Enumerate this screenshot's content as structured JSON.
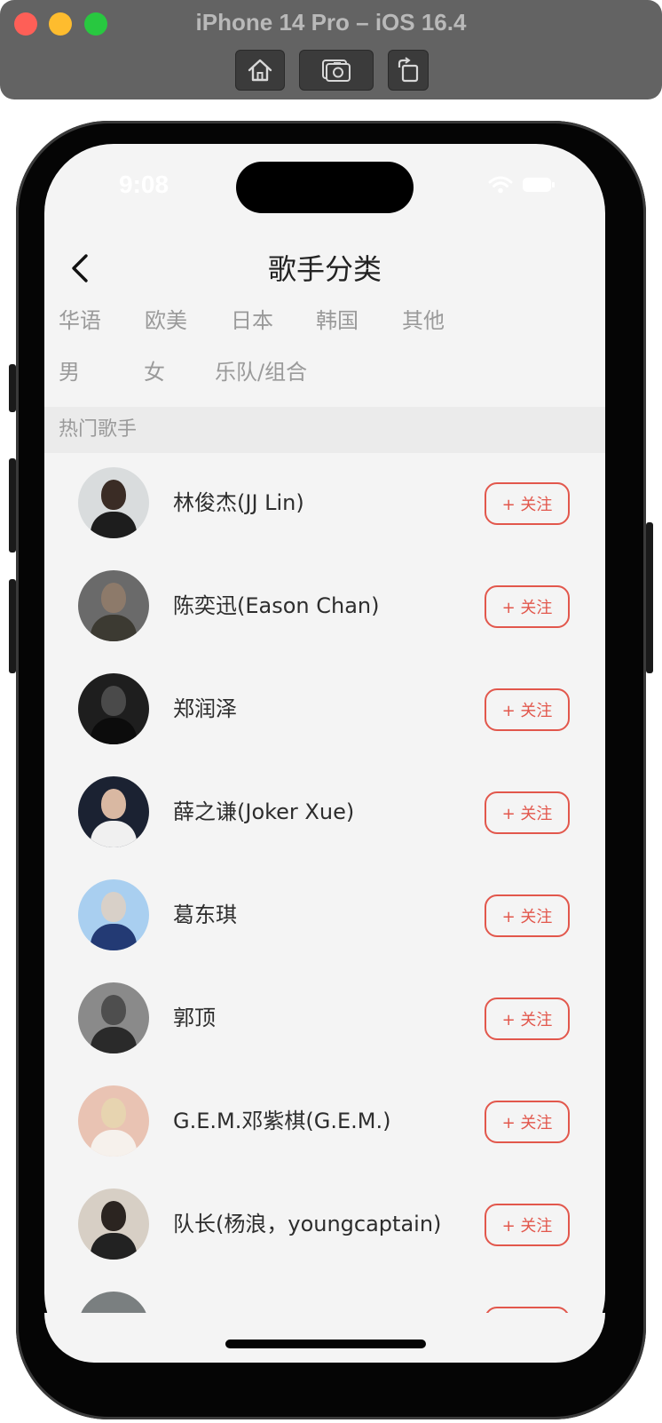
{
  "simulator": {
    "title": "iPhone 14 Pro – iOS 16.4",
    "buttons": [
      "home-icon",
      "screenshot-icon",
      "rotate-icon"
    ]
  },
  "status_bar": {
    "time": "9:08"
  },
  "nav": {
    "title": "歌手分类",
    "back_icon": "chevron-left-icon"
  },
  "filters": {
    "region": [
      "华语",
      "欧美",
      "日本",
      "韩国",
      "其他"
    ],
    "type": [
      "男",
      "女",
      "乐队/组合"
    ]
  },
  "section": {
    "title": "热门歌手"
  },
  "singers": [
    {
      "name": "林俊杰(JJ Lin)",
      "follow": "+ 关注"
    },
    {
      "name": "陈奕迅(Eason Chan)",
      "follow": "+ 关注"
    },
    {
      "name": "郑润泽",
      "follow": "+ 关注"
    },
    {
      "name": "薛之谦(Joker Xue)",
      "follow": "+ 关注"
    },
    {
      "name": "葛东琪",
      "follow": "+ 关注"
    },
    {
      "name": "郭顶",
      "follow": "+ 关注"
    },
    {
      "name": "G.E.M.邓紫棋(G.E.M.)",
      "follow": "+ 关注"
    },
    {
      "name": "队长(杨浪，youngcaptain)",
      "follow": "+ 关注"
    },
    {
      "name": "",
      "follow": ""
    }
  ],
  "colors": {
    "accent": "#e2574c",
    "screen_bg": "#f4f4f4",
    "section_bg": "#ebebeb",
    "muted_text": "#9a9a9a"
  }
}
